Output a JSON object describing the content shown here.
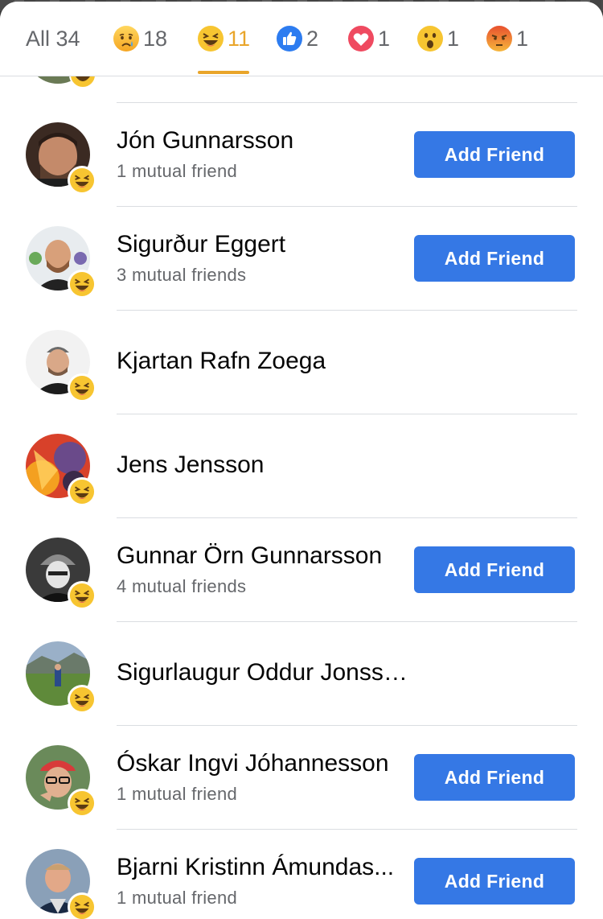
{
  "tabs": [
    {
      "icon": "all",
      "label": "All 34",
      "active": false
    },
    {
      "icon": "sad-icon",
      "count": "18",
      "active": false
    },
    {
      "icon": "haha-icon",
      "count": "11",
      "active": true
    },
    {
      "icon": "like-icon",
      "count": "2",
      "active": false
    },
    {
      "icon": "love-icon",
      "count": "1",
      "active": false
    },
    {
      "icon": "wow-icon",
      "count": "1",
      "active": false
    },
    {
      "icon": "angry-icon",
      "count": "1",
      "active": false
    }
  ],
  "people": [
    {
      "name": "Jón Gunnarsson",
      "mutual": "1 mutual friend",
      "button": "Add Friend"
    },
    {
      "name": "Sigurður Eggert",
      "mutual": "3 mutual friends",
      "button": "Add Friend"
    },
    {
      "name": "Kjartan Rafn Zoega"
    },
    {
      "name": "Jens Jensson"
    },
    {
      "name": "Gunnar Örn Gunnarsson",
      "mutual": "4 mutual friends",
      "button": "Add Friend"
    },
    {
      "name": "Sigurlaugur Oddur Jonsson"
    },
    {
      "name": "Óskar Ingvi Jóhannesson",
      "mutual": "1 mutual friend",
      "button": "Add Friend"
    },
    {
      "name": "Bjarni Kristinn Ámundas...",
      "mutual": "1 mutual friend",
      "button": "Add Friend"
    }
  ],
  "colors": {
    "accent": "#e9a52a",
    "button": "#3578e5",
    "haha": "#f7c531"
  }
}
